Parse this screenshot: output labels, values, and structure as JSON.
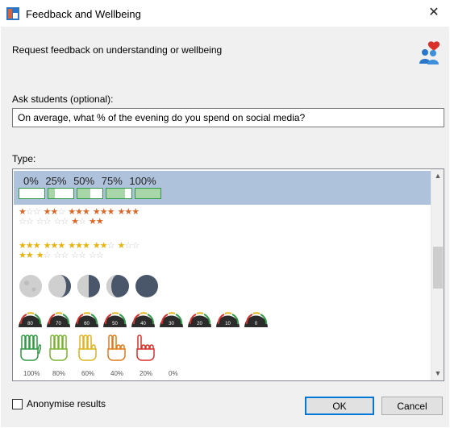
{
  "window": {
    "title": "Feedback and Wellbeing",
    "close_glyph": "✕",
    "icon": "app-icon"
  },
  "dialog": {
    "description": "Request feedback on understanding or wellbeing",
    "icon": "feedback-people-icon",
    "ask_label": "Ask students (optional):",
    "ask_value": "On average, what % of the evening do you spend on social media?",
    "type_label": "Type:"
  },
  "types": {
    "selected_index": 0,
    "percent_bars": {
      "labels": [
        "0%",
        "25%",
        "50%",
        "75%",
        "100%"
      ],
      "fill_fractions": [
        0,
        0.25,
        0.5,
        0.75,
        1
      ],
      "bar_color": "#2e9a43",
      "fill_color": "#a8d6a9"
    },
    "stars_orange": {
      "color": "#d9682a",
      "row1": [
        "★☆☆",
        "★★☆",
        "★★★",
        "★★★",
        "★★★"
      ],
      "row2": [
        "☆☆",
        "☆☆",
        "☆☆",
        "★☆",
        "★★"
      ]
    },
    "stars_gold": {
      "color": "#e8b30c",
      "row1": [
        "★★★",
        "★★★",
        "★★★",
        "★★☆",
        "★☆☆"
      ],
      "row2": [
        "★★",
        "★☆",
        "☆☆",
        "☆☆",
        "☆☆"
      ]
    },
    "moons": {
      "phases": [
        "full",
        "waning-gibbous",
        "half",
        "waning-crescent",
        "new"
      ]
    },
    "gauges": {
      "readouts": [
        "80",
        "70",
        "60",
        "50",
        "40",
        "30",
        "20",
        "10",
        "0"
      ]
    },
    "hands": {
      "counts": [
        5,
        4,
        3,
        2,
        1
      ],
      "colors": [
        "#2e9a43",
        "#7ab32e",
        "#e0b41a",
        "#e07a1a",
        "#d9302a"
      ],
      "labels": [
        "100%",
        "80%",
        "60%",
        "40%",
        "20%",
        "0%"
      ]
    }
  },
  "options": {
    "anonymise_label": "Anonymise results",
    "anonymise_checked": false
  },
  "buttons": {
    "ok": "OK",
    "cancel": "Cancel"
  },
  "scrollbar": {
    "up_glyph": "▲",
    "down_glyph": "▼"
  }
}
